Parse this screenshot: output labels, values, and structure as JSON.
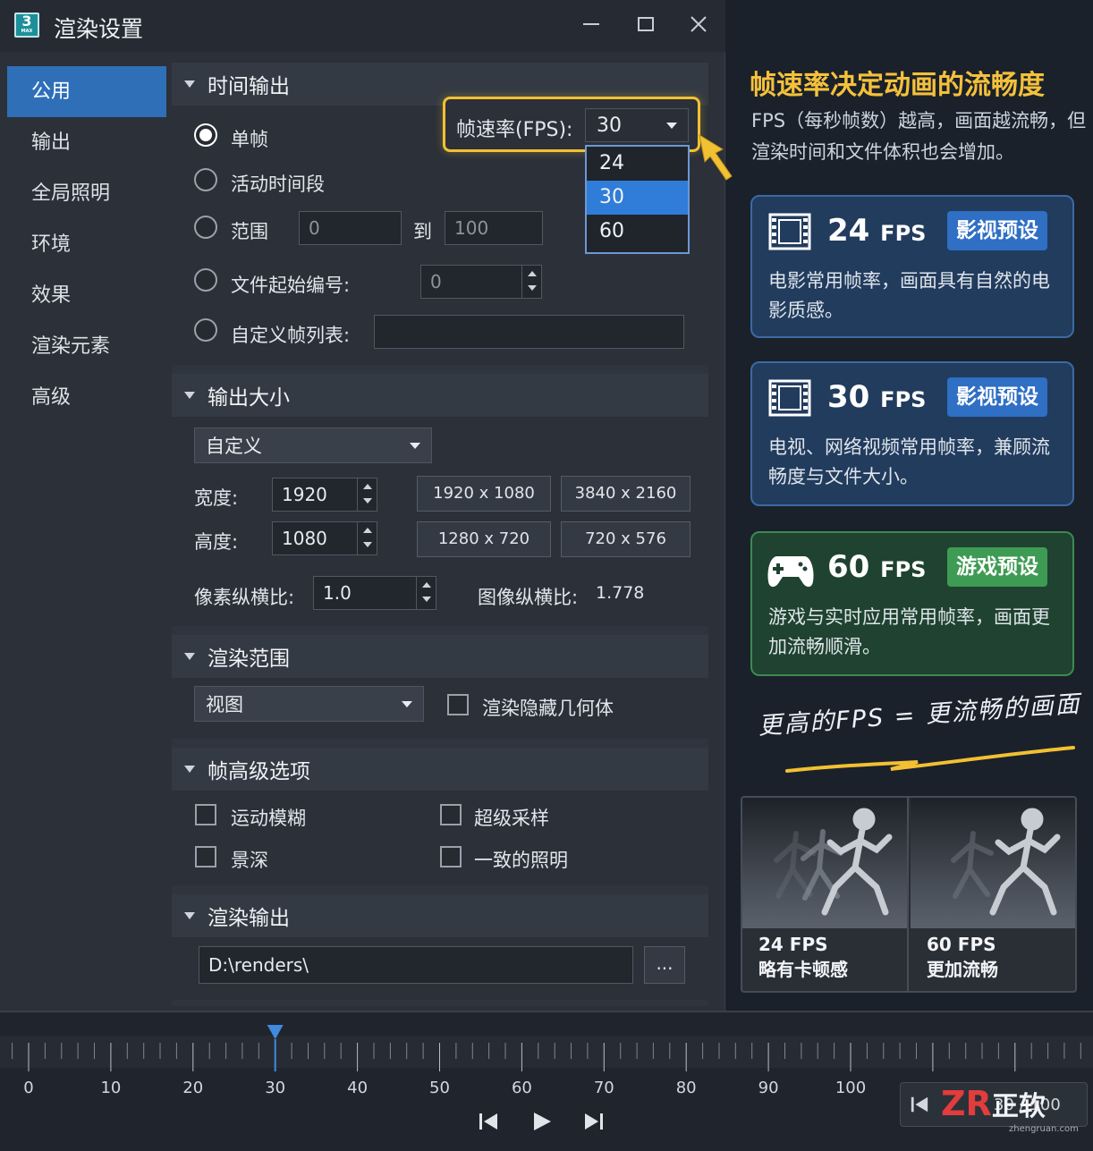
{
  "window": {
    "title": "渲染设置",
    "app_icon_text": "3",
    "app_icon_sub": "MAX"
  },
  "sidebar": {
    "items": [
      {
        "label": "公用",
        "active": true
      },
      {
        "label": "输出"
      },
      {
        "label": "全局照明"
      },
      {
        "label": "环境"
      },
      {
        "label": "效果"
      },
      {
        "label": "渲染元素"
      },
      {
        "label": "高级"
      }
    ]
  },
  "time_output": {
    "header": "时间输出",
    "radio_single": "单帧",
    "radio_active": "活动时间段",
    "radio_range": "范围",
    "range_from": "0",
    "range_to_label": "到",
    "range_to": "100",
    "radio_file_start": "文件起始编号:",
    "file_start_value": "0",
    "radio_custom": "自定义帧列表:",
    "custom_value": "",
    "fps_label": "帧速率(FPS):",
    "fps_value": "30",
    "fps_options": [
      "24",
      "30",
      "60"
    ],
    "fps_selected": "30"
  },
  "output_size": {
    "header": "输出大小",
    "preset": "自定义",
    "width_label": "宽度:",
    "width_value": "1920",
    "height_label": "高度:",
    "height_value": "1080",
    "presets": [
      "1920 x 1080",
      "3840 x 2160",
      "1280 x 720",
      "720 x 576"
    ],
    "pixel_aspect_label": "像素纵横比:",
    "pixel_aspect_value": "1.0",
    "image_aspect_label": "图像纵横比:",
    "image_aspect_value": "1.778"
  },
  "render_scope": {
    "header": "渲染范围",
    "view": "视图",
    "hidden_geometry": "渲染隐藏几何体"
  },
  "frame_advanced": {
    "header": "帧高级选项",
    "motion_blur": "运动模糊",
    "supersampling": "超级采样",
    "dof": "景深",
    "consistent_lighting": "一致的照明"
  },
  "render_output": {
    "header": "渲染输出",
    "path": "D:\\renders\\",
    "browse": "..."
  },
  "info": {
    "title": "帧速率决定动画的流畅度",
    "desc": "FPS（每秒帧数）越高，画面越流畅，但渲染时间和文件体积也会增加。",
    "cards": [
      {
        "fps": "24",
        "unit": "FPS",
        "badge": "影视预设",
        "text": "电影常用帧率，画面具有自然的电影质感。",
        "icon": "film-icon"
      },
      {
        "fps": "30",
        "unit": "FPS",
        "badge": "影视预设",
        "text": "电视、网络视频常用帧率，兼顾流畅度与文件大小。",
        "icon": "film-icon"
      },
      {
        "fps": "60",
        "unit": "FPS",
        "badge": "游戏预设",
        "text": "游戏与实时应用常用帧率，画面更加流畅顺滑。",
        "icon": "gamepad-icon"
      }
    ],
    "slogan": "更高的FPS = 更流畅的画面",
    "compare": [
      {
        "fps": "24 FPS",
        "caption": "略有卡顿感"
      },
      {
        "fps": "60 FPS",
        "caption": "更加流畅"
      }
    ]
  },
  "timeline": {
    "ticks": [
      "0",
      "10",
      "20",
      "30",
      "40",
      "50",
      "60",
      "70",
      "80",
      "90",
      "100"
    ],
    "current_frame": 30,
    "mini_range": "30 / 100"
  },
  "watermark": {
    "logo": "ZR",
    "text": "正软",
    "url": "zhengruan.com"
  },
  "colors": {
    "accent": "#2f6fb8",
    "highlight": "#f2c032",
    "card_blue": "#223c5e",
    "card_green": "#1f4330"
  }
}
